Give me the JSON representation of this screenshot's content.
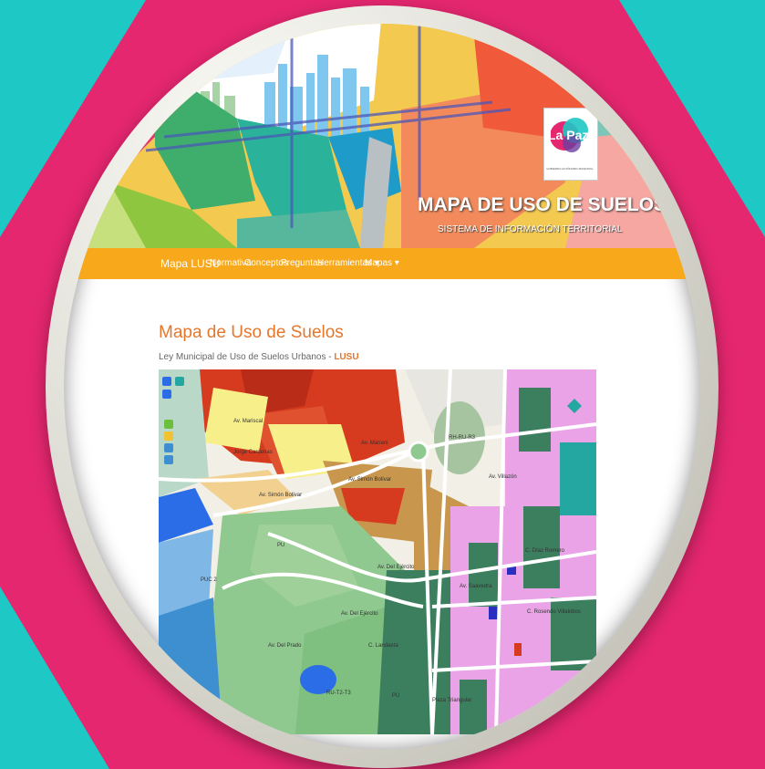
{
  "site": {
    "logo_text": "La Paz",
    "logo_subtext": "GOBIERNO AUTÓNOMO MUNICIPAL",
    "title": "MAPA DE USO DE SUELOS",
    "subtitle": "SISTEMA DE INFORMACIÓN TERRITORIAL"
  },
  "nav": {
    "brand": "Mapa LUSU",
    "items": [
      "Normativa",
      "Conceptos",
      "Preguntas",
      "Herramientas ▾",
      "Mapas ▾"
    ]
  },
  "page": {
    "title": "Mapa de Uso de Suelos",
    "subtitle_prefix": "Ley Municipal de Uso de Suelos Urbanos - ",
    "subtitle_emph": "LUSU"
  },
  "map": {
    "controls": [
      "zoom-icon",
      "layers-icon",
      "info-icon",
      "measure-icon",
      "print-icon",
      "share-icon",
      "locate-icon"
    ],
    "labels": [
      "Av. Mariscal",
      "Jorge Cardenas",
      "Av. Mariani",
      "Av. Simón Bolívar",
      "Av. Simón Bolívar",
      "PU",
      "RH-RU-R3",
      "C. Díaz Romero",
      "C. Rosendo Villalobos",
      "Av. Del Ejército",
      "Av. Del Ejército",
      "PUC 2",
      "Av. Del Prado",
      "C. Landaeta",
      "Av. Saavedra",
      "Av. Villazón",
      "PU",
      "RU-T2-T3",
      "Plaza Triangular"
    ],
    "colors": {
      "red": "#d63a1f",
      "green": "#8fc98f",
      "pink": "#e9a3e6",
      "yellow": "#f7f08a",
      "blue": "#2b6de6",
      "teal": "#24a7a0"
    }
  },
  "colors": {
    "accent": "#f7a81b",
    "brand_pink": "#e5276f",
    "brand_teal": "#1ec8c4",
    "title_orange": "#e6762c"
  }
}
